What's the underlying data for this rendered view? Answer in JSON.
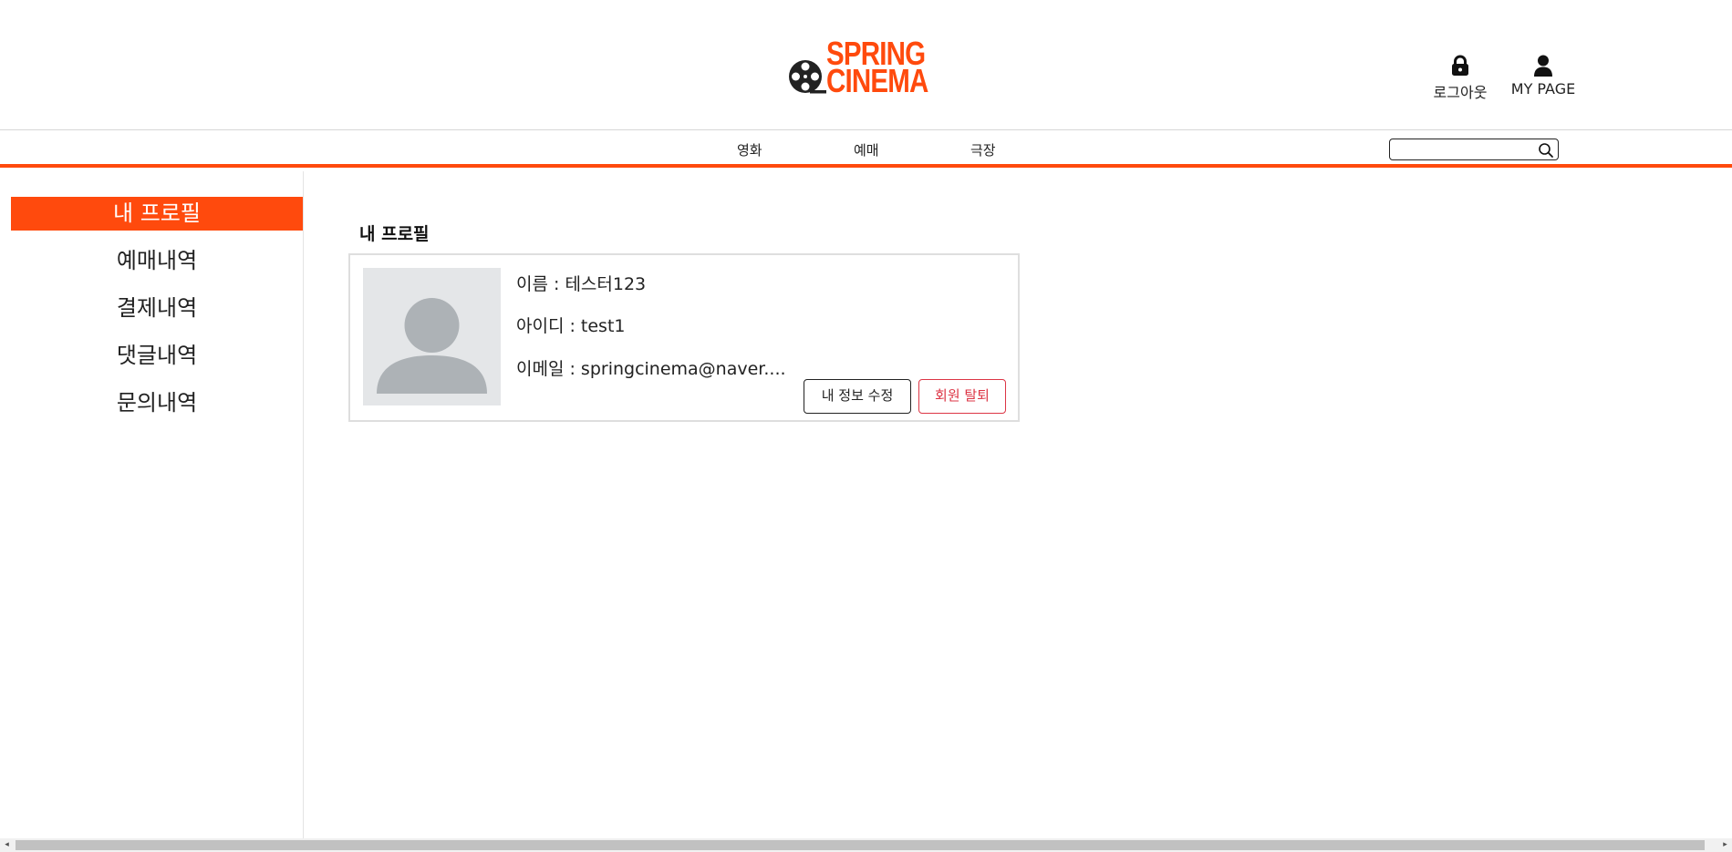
{
  "header": {
    "logo": {
      "line1": "SPRING",
      "line2": "CINEMA",
      "brand_color": "#ff4a0d"
    },
    "logout": {
      "label": "로그아웃",
      "icon": "lock-icon"
    },
    "mypage": {
      "label": "MY PAGE",
      "icon": "user-icon"
    }
  },
  "nav": {
    "items": [
      "영화",
      "예매",
      "극장"
    ],
    "search": {
      "value": "",
      "placeholder": "",
      "icon": "search-icon"
    },
    "accent_color": "#ff4a0d"
  },
  "sidebar": {
    "items": [
      {
        "label": "내 프로필",
        "active": true
      },
      {
        "label": "예매내역",
        "active": false
      },
      {
        "label": "결제내역",
        "active": false
      },
      {
        "label": "댓글내역",
        "active": false
      },
      {
        "label": "문의내역",
        "active": false
      }
    ]
  },
  "main": {
    "section_title": "내 프로필",
    "profile": {
      "avatar_icon": "default-avatar-icon",
      "name_line": "이름 : 테스터123",
      "id_line": "아이디 : test1",
      "email_line": "이메일 : springcinema@naver....",
      "edit_button": "내 정보 수정",
      "withdraw_button": "회원 탈퇴",
      "withdraw_color": "#dc3545"
    }
  },
  "scrollbar": {
    "left_arrow": "◂",
    "right_arrow": "▸"
  }
}
